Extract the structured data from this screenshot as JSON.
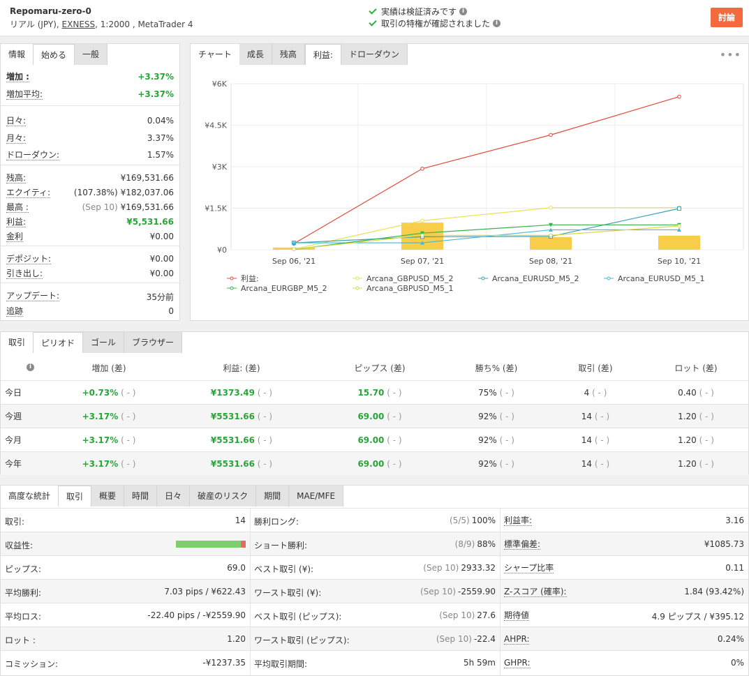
{
  "header": {
    "account_name": "Repomaru-zero-0",
    "account_type": "リアル (JPY),",
    "broker": "EXNESS",
    "account_rest": ", 1:2000 , MetaTrader 4",
    "verified_1": "実績は検証済みです",
    "verified_2": "取引の特権が確認されました",
    "discuss_label": "討論"
  },
  "info_panel": {
    "tabs": [
      "情報",
      "始める",
      "一般"
    ],
    "active_tab": 1,
    "rows": [
      {
        "key": "増加 :",
        "value": "+3.37%",
        "green": true,
        "bold": true
      },
      {
        "key": "増加平均:",
        "value": "+3.37%",
        "green": true
      },
      {
        "key": "日々:",
        "value": "0.04%"
      },
      {
        "key": "月々:",
        "value": "3.37%"
      },
      {
        "key": "ドローダウン:",
        "value": "1.57%"
      },
      {
        "key": "残高:",
        "value": "¥169,531.66"
      },
      {
        "key": "エクイティ:",
        "prefix": "(107.38%)",
        "prefix_dark": true,
        "value": "¥182,037.06"
      },
      {
        "key": "最高 :",
        "prefix": "(Sep 10)",
        "value": "¥169,531.66"
      },
      {
        "key": "利益:",
        "value": "¥5,531.66",
        "green": true
      },
      {
        "key": "金利",
        "value": "¥0.00"
      },
      {
        "key": "デポジット:",
        "value": "¥0.00"
      },
      {
        "key": "引き出し:",
        "value": "¥0.00"
      },
      {
        "key": "アップデート:",
        "value": "35分前"
      },
      {
        "key": "追跡",
        "value": "0"
      }
    ]
  },
  "chart_panel": {
    "tabs": [
      "チャート",
      "成長",
      "残高",
      "利益:",
      "ドローダウン"
    ],
    "active_tab": 3,
    "more_icon": "more-icon"
  },
  "chart_data": {
    "type": "line",
    "categories": [
      "Sep 06, '21",
      "Sep 07, '21",
      "Sep 08, '21",
      "Sep 10, '21"
    ],
    "yticks": [
      "¥0",
      "¥1.5K",
      "¥3K",
      "¥4.5K",
      "¥6K"
    ],
    "ylim": [
      0,
      6000
    ],
    "bars": [
      80,
      980,
      460,
      510
    ],
    "bar_color": "#f7cd4a",
    "series": [
      {
        "name": "利益:",
        "color": "#e24b3b",
        "marker": "circle",
        "values": [
          220,
          2930,
          4150,
          5531
        ]
      },
      {
        "name": "Arcana_GBPUSD_M5_2",
        "color": "#e7e24a",
        "marker": "circle",
        "values": [
          20,
          1050,
          1520,
          1520
        ]
      },
      {
        "name": "Arcana_EURUSD_M5_2",
        "color": "#3aa0b8",
        "marker": "square",
        "values": [
          250,
          470,
          480,
          1490
        ]
      },
      {
        "name": "Arcana_EURUSD_M5_1",
        "color": "#3fb9dc",
        "marker": "triangle",
        "values": [
          250,
          250,
          720,
          720
        ]
      },
      {
        "name": "Arcana_EURGBP_M5_2",
        "color": "#35b24c",
        "marker": "triangle-down",
        "values": [
          10,
          600,
          900,
          900
        ]
      },
      {
        "name": "Arcana_GBPUSD_M5_1",
        "color": "#d8d84a",
        "marker": "circle",
        "values": [
          20,
          520,
          520,
          860
        ]
      }
    ]
  },
  "period_panel": {
    "tabs": [
      "取引",
      "ピリオド",
      "ゴール",
      "ブラウザー"
    ],
    "active_tab": 1,
    "info_icon": "info-icon",
    "headers": [
      "増加 (差)",
      "利益: (差)",
      "ピップス (差)",
      "勝ち% (差)",
      "取引 (差)",
      "ロット (差)"
    ],
    "diff_text": "( - )",
    "rows": [
      {
        "label": "今日",
        "gain": "+0.73%",
        "profit": "¥1373.49",
        "pips": "15.70",
        "win": "75%",
        "trades": "4",
        "lots": "0.40"
      },
      {
        "label": "今週",
        "gain": "+3.17%",
        "profit": "¥5531.66",
        "pips": "69.00",
        "win": "92%",
        "trades": "14",
        "lots": "1.20"
      },
      {
        "label": "今月",
        "gain": "+3.17%",
        "profit": "¥5531.66",
        "pips": "69.00",
        "win": "92%",
        "trades": "14",
        "lots": "1.20"
      },
      {
        "label": "今年",
        "gain": "+3.17%",
        "profit": "¥5531.66",
        "pips": "69.00",
        "win": "92%",
        "trades": "14",
        "lots": "1.20"
      }
    ]
  },
  "stats_panel": {
    "tabs": [
      "高度な統計",
      "取引",
      "概要",
      "時間",
      "日々",
      "破産のリスク",
      "期間",
      "MAE/MFE"
    ],
    "active_tab": 1,
    "profitability_fraction": 0.93,
    "rows": [
      [
        {
          "k": "取引:",
          "v": "14"
        },
        {
          "k": "勝利ロング:",
          "pre": "(5/5)",
          "v": "100%"
        },
        {
          "k": "利益率:",
          "v": "3.16",
          "u": true
        }
      ],
      [
        {
          "k": "収益性:",
          "bar": true
        },
        {
          "k": "ショート勝利:",
          "pre": "(8/9)",
          "v": "88%"
        },
        {
          "k": "標準偏差:",
          "v": "¥1085.73",
          "u": true
        }
      ],
      [
        {
          "k": "ピップス:",
          "v": "69.0"
        },
        {
          "k": "ベスト取引 (¥):",
          "pre": "(Sep 10)",
          "v": "2933.32"
        },
        {
          "k": "シャープ比率",
          "v": "0.11",
          "u": true
        }
      ],
      [
        {
          "k": "平均勝利:",
          "v": "7.03 pips / ¥622.43"
        },
        {
          "k": "ワースト取引 (¥):",
          "pre": "(Sep 10)",
          "v": "-2559.90"
        },
        {
          "k": "Z-スコア (確率):",
          "v": "1.84 (93.42%)",
          "u": true
        }
      ],
      [
        {
          "k": "平均ロス:",
          "v": "-22.40 pips / -¥2559.90"
        },
        {
          "k": "ベスト取引 (ピップス):",
          "pre": "(Sep 10)",
          "v": "27.6"
        },
        {
          "k": "期待値",
          "v": "4.9 ピップス / ¥395.12",
          "u": true
        }
      ],
      [
        {
          "k": "ロット :",
          "v": "1.20"
        },
        {
          "k": "ワースト取引 (ピップス):",
          "pre": "(Sep 10)",
          "v": "-22.4"
        },
        {
          "k": "AHPR:",
          "v": "0.24%",
          "u": true
        }
      ],
      [
        {
          "k": "コミッション:",
          "v": "-¥1237.35"
        },
        {
          "k": "平均取引期間:",
          "v": "5h 59m"
        },
        {
          "k": "GHPR:",
          "v": "0%",
          "u": true
        }
      ]
    ]
  }
}
